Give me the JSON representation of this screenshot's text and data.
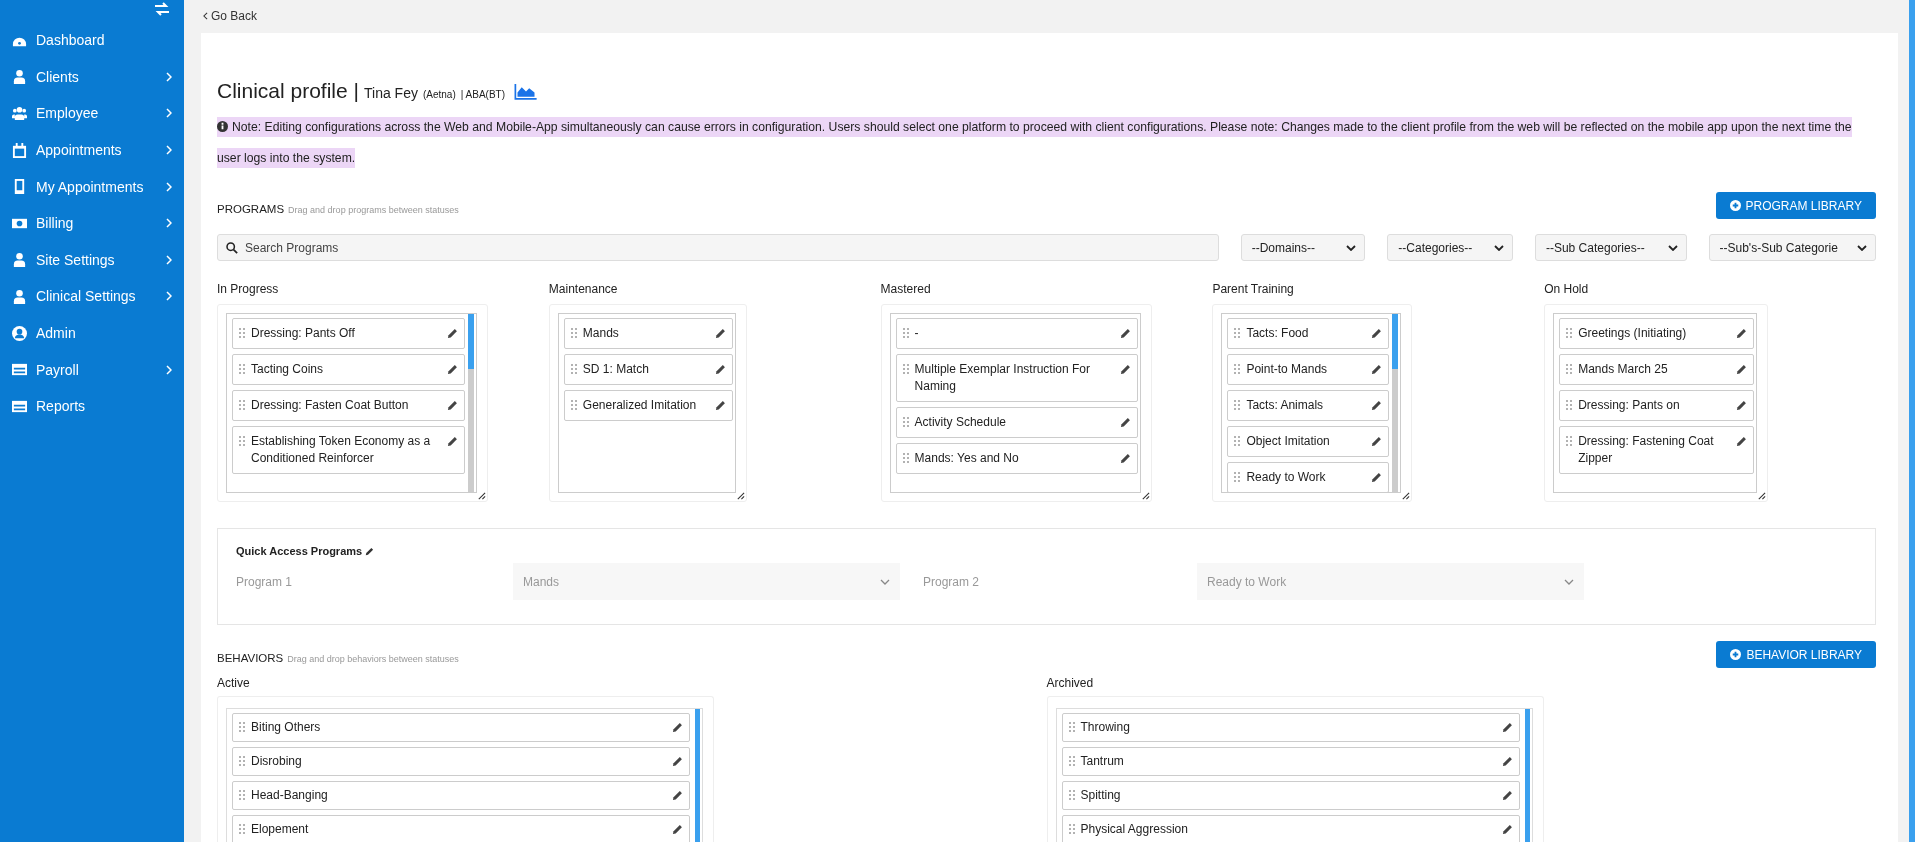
{
  "sidebar": {
    "items": [
      {
        "label": "Dashboard",
        "has_submenu": false
      },
      {
        "label": "Clients",
        "has_submenu": true
      },
      {
        "label": "Employee",
        "has_submenu": true
      },
      {
        "label": "Appointments",
        "has_submenu": true
      },
      {
        "label": "My Appointments",
        "has_submenu": true
      },
      {
        "label": "Billing",
        "has_submenu": true
      },
      {
        "label": "Site Settings",
        "has_submenu": true
      },
      {
        "label": "Clinical Settings",
        "has_submenu": true
      },
      {
        "label": "Admin",
        "has_submenu": false
      },
      {
        "label": "Payroll",
        "has_submenu": true
      },
      {
        "label": "Reports",
        "has_submenu": false
      }
    ]
  },
  "go_back": "Go Back",
  "header": {
    "title": "Clinical profile |",
    "client_name": "Tina Fey",
    "payer": "(Aetna)",
    "service": "| ABA(BT)"
  },
  "note": "Note: Editing configurations across the Web and Mobile-App simultaneously can cause errors in configuration. Users should select one platform to proceed with client configurations. Please note: Changes made to the client profile from the web will be reflected on the mobile app upon the next time the user logs into the system.",
  "programs": {
    "heading": "PROGRAMS",
    "hint": "Drag and drop programs between statuses",
    "library_button": "PROGRAM LIBRARY",
    "search": {
      "placeholder": "Search Programs"
    },
    "filters": [
      "--Domains--",
      "--Categories--",
      "--Sub Categories--",
      "--Sub's-Sub Categorie"
    ],
    "columns": [
      {
        "title": "In Progress",
        "items": [
          "Dressing: Pants Off",
          "Tacting Coins",
          "Dressing: Fasten Coat Button",
          "Establishing Token Economy as a Conditioned Reinforcer"
        ]
      },
      {
        "title": "Maintenance",
        "items": [
          "Mands",
          "SD 1: Match",
          "Generalized Imitation"
        ]
      },
      {
        "title": "Mastered",
        "items": [
          "-",
          "Multiple Exemplar Instruction For Naming",
          "Activity Schedule",
          "Mands: Yes and No"
        ]
      },
      {
        "title": "Parent Training",
        "items": [
          "Tacts: Food",
          "Point-to Mands",
          "Tacts: Animals",
          "Object Imitation",
          "Ready to Work"
        ]
      },
      {
        "title": "On Hold",
        "items": [
          "Greetings (Initiating)",
          "Mands March 25",
          "Dressing: Pants on",
          "Dressing: Fastening Coat Zipper"
        ]
      }
    ]
  },
  "quick_access": {
    "title": "Quick Access Programs",
    "programs": [
      {
        "label": "Program 1",
        "value": "Mands"
      },
      {
        "label": "Program 2",
        "value": "Ready to Work"
      }
    ]
  },
  "behaviors": {
    "heading": "BEHAVIORS",
    "hint": "Drag and drop behaviors between statuses",
    "library_button": "BEHAVIOR LIBRARY",
    "columns": [
      {
        "title": "Active",
        "items": [
          "Biting Others",
          "Disrobing",
          "Head-Banging",
          "Elopement"
        ]
      },
      {
        "title": "Archived",
        "items": [
          "Throwing",
          "Tantrum",
          "Spitting",
          "Physical Aggression"
        ]
      }
    ]
  }
}
